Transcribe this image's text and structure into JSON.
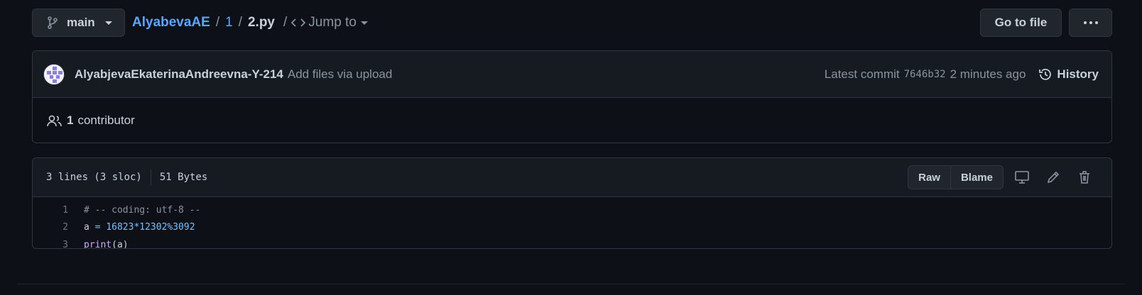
{
  "topbar": {
    "branch": "main",
    "owner": "AlyabevaAE",
    "dir": "1",
    "file": "2.py",
    "jump_to": "Jump to",
    "goto_file": "Go to file"
  },
  "commit": {
    "author": "AlyabjevaEkaterinaAndreevna-Y-214",
    "message": "Add files via upload",
    "latest_label": "Latest commit",
    "sha": "7646b32",
    "time": "2 minutes ago",
    "history": "History"
  },
  "contributors": {
    "count": "1",
    "label": "contributor"
  },
  "file": {
    "lines": "3 lines (3 sloc)",
    "size": "51 Bytes",
    "raw": "Raw",
    "blame": "Blame",
    "code": [
      {
        "n": "1",
        "parts": [
          {
            "t": "# -- coding: utf-8 --",
            "c": "c-comment"
          }
        ]
      },
      {
        "n": "2",
        "parts": [
          {
            "t": "a ",
            "c": ""
          },
          {
            "t": "=",
            "c": "c-op"
          },
          {
            "t": " ",
            "c": ""
          },
          {
            "t": "16823*12302%3092",
            "c": "c-num"
          }
        ]
      },
      {
        "n": "3",
        "parts": [
          {
            "t": "print",
            "c": "c-fn"
          },
          {
            "t": "(a)",
            "c": ""
          }
        ]
      }
    ]
  },
  "colors": {
    "background": "#0d1117",
    "link": "#58a6ff",
    "muted": "#8b949e",
    "border": "#30363d"
  }
}
